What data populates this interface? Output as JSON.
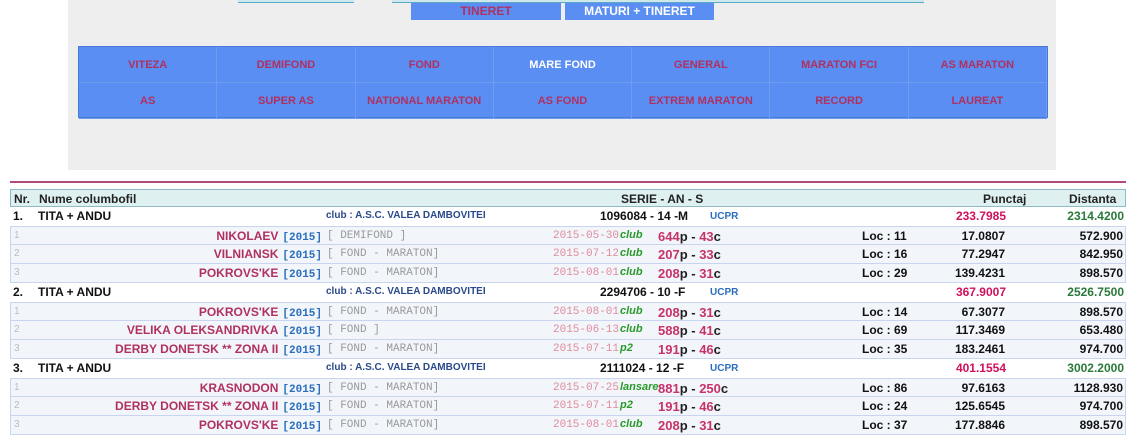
{
  "top_tabs": [
    {
      "label": "TINERET",
      "active": true
    },
    {
      "label": "MATURI + TINERET",
      "active": false
    }
  ],
  "categories": [
    {
      "label": "VITEZA",
      "selected": false
    },
    {
      "label": "DEMIFOND",
      "selected": false
    },
    {
      "label": "FOND",
      "selected": false
    },
    {
      "label": "MARE FOND",
      "selected": true
    },
    {
      "label": "GENERAL",
      "selected": false
    },
    {
      "label": "MARATON FCI",
      "selected": false
    },
    {
      "label": "AS MARATON",
      "selected": false
    },
    {
      "label": "AS",
      "selected": false
    },
    {
      "label": "SUPER AS",
      "selected": false
    },
    {
      "label": "NATIONAL MARATON",
      "selected": false
    },
    {
      "label": "AS FOND",
      "selected": false
    },
    {
      "label": "EXTREM MARATON",
      "selected": false
    },
    {
      "label": "RECORD",
      "selected": false
    },
    {
      "label": "LAUREAT",
      "selected": false
    }
  ],
  "table": {
    "headers": {
      "nr": "Nr.",
      "name": "Nume columbofil",
      "serie": "SERIE - AN - S",
      "punctaj": "Punctaj",
      "distanta": "Distanta"
    },
    "groups": [
      {
        "rank": "1.",
        "name": "TITA + ANDU",
        "club": "club : A.S.C. VALEA DAMBOVITEI",
        "serie": "1096084 - 14 -M",
        "org": "UCPR",
        "punctaj": "233.7985",
        "distanta": "2314.4200",
        "races": [
          {
            "idx": "1",
            "race": "NIKOLAEV",
            "year": "[2015]",
            "cat": "[ DEMIFOND ]",
            "date": "2015-05-30",
            "type": "club",
            "p": "644",
            "c": "43",
            "loc": "Loc : 11",
            "punctaj": "17.0807",
            "distanta": "572.900"
          },
          {
            "idx": "2",
            "race": "VILNIANSK",
            "year": "[2015]",
            "cat": "[ FOND - MARATON]",
            "date": "2015-07-12",
            "type": "club",
            "p": "207",
            "c": "33",
            "loc": "Loc : 16",
            "punctaj": "77.2947",
            "distanta": "842.950"
          },
          {
            "idx": "3",
            "race": "POKROVS'KE",
            "year": "[2015]",
            "cat": "[ FOND - MARATON]",
            "date": "2015-08-01",
            "type": "club",
            "p": "208",
            "c": "31",
            "loc": "Loc : 29",
            "punctaj": "139.4231",
            "distanta": "898.570"
          }
        ]
      },
      {
        "rank": "2.",
        "name": "TITA + ANDU",
        "club": "club : A.S.C. VALEA DAMBOVITEI",
        "serie": "2294706 - 10 -F",
        "org": "UCPR",
        "punctaj": "367.9007",
        "distanta": "2526.7500",
        "races": [
          {
            "idx": "1",
            "race": "POKROVS'KE",
            "year": "[2015]",
            "cat": "[ FOND - MARATON]",
            "date": "2015-08-01",
            "type": "club",
            "p": "208",
            "c": "31",
            "loc": "Loc : 14",
            "punctaj": "67.3077",
            "distanta": "898.570"
          },
          {
            "idx": "2",
            "race": "VELIKA OLEKSANDRIVKA",
            "year": "[2015]",
            "cat": "[ FOND ]",
            "date": "2015-06-13",
            "type": "club",
            "p": "588",
            "c": "41",
            "loc": "Loc : 69",
            "punctaj": "117.3469",
            "distanta": "653.480"
          },
          {
            "idx": "3",
            "race": "DERBY DONETSK ** ZONA II",
            "year": "[2015]",
            "cat": "[ FOND - MARATON]",
            "date": "2015-07-11",
            "type": "p2",
            "p": "191",
            "c": "46",
            "loc": "Loc : 35",
            "punctaj": "183.2461",
            "distanta": "974.700"
          }
        ]
      },
      {
        "rank": "3.",
        "name": "TITA + ANDU",
        "club": "club : A.S.C. VALEA DAMBOVITEI",
        "serie": "2111024 - 12 -F",
        "org": "UCPR",
        "punctaj": "401.1554",
        "distanta": "3002.2000",
        "races": [
          {
            "idx": "1",
            "race": "KRASNODON",
            "year": "[2015]",
            "cat": "[ FOND - MARATON]",
            "date": "2015-07-25",
            "type": "lansare",
            "p": "881",
            "c": "250",
            "loc": "Loc : 86",
            "punctaj": "97.6163",
            "distanta": "1128.930"
          },
          {
            "idx": "2",
            "race": "DERBY DONETSK ** ZONA II",
            "year": "[2015]",
            "cat": "[ FOND - MARATON]",
            "date": "2015-07-11",
            "type": "p2",
            "p": "191",
            "c": "46",
            "loc": "Loc : 24",
            "punctaj": "125.6545",
            "distanta": "974.700"
          },
          {
            "idx": "3",
            "race": "POKROVS'KE",
            "year": "[2015]",
            "cat": "[ FOND - MARATON]",
            "date": "2015-08-01",
            "type": "club",
            "p": "208",
            "c": "31",
            "loc": "Loc : 37",
            "punctaj": "177.8846",
            "distanta": "898.570"
          }
        ]
      }
    ]
  }
}
